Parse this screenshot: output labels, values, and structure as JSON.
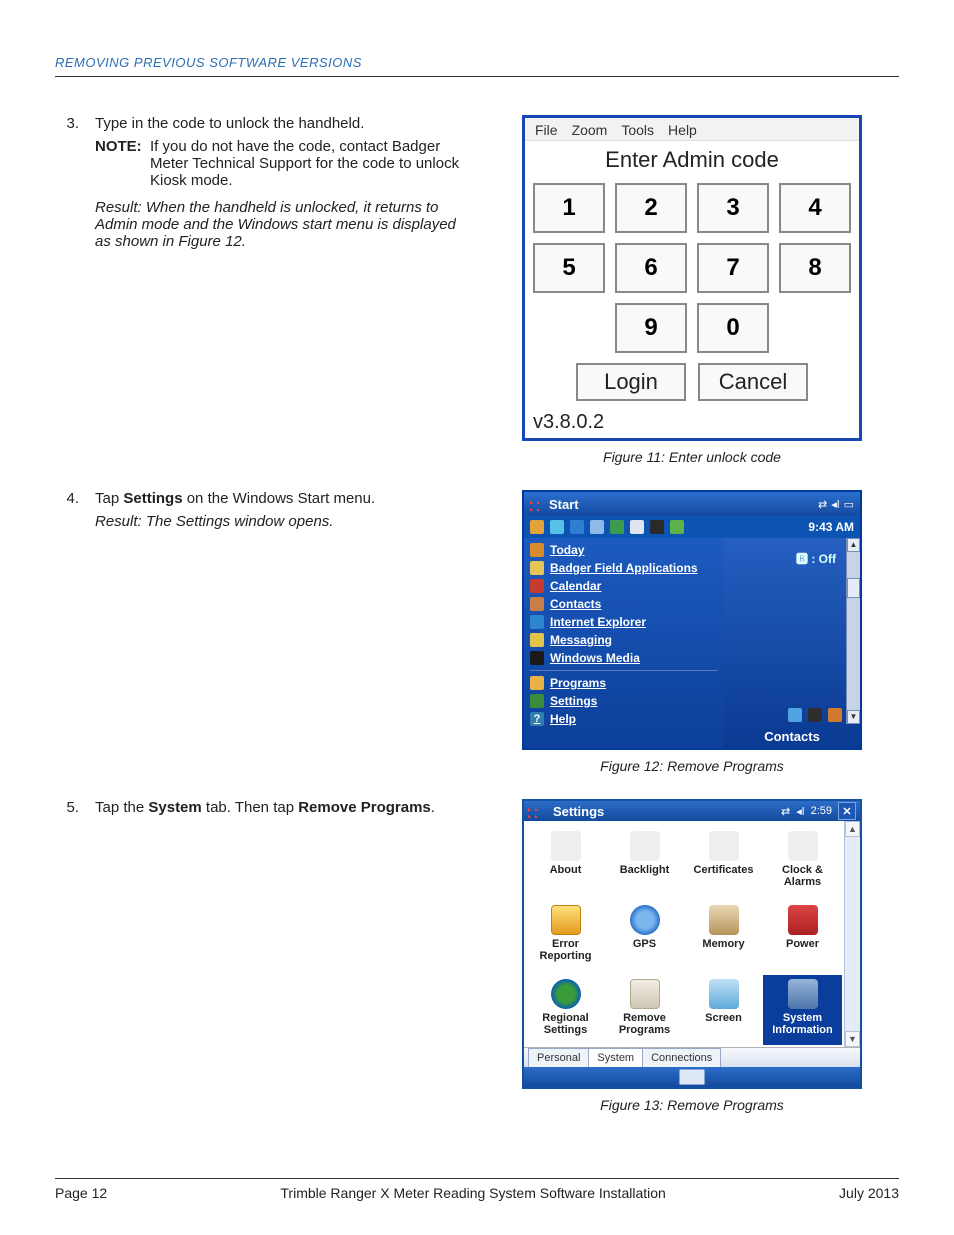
{
  "header": {
    "section_title": "REMOVING PREVIOUS SOFTWARE VERSIONS"
  },
  "steps": {
    "s3": {
      "num": "3.",
      "text": "Type in the code to unlock the handheld.",
      "note_label": "NOTE:",
      "note_text": "If you do not have the code, contact Badger Meter Technical Support for the code to unlock Kiosk mode.",
      "result": "Result: When the handheld is unlocked, it returns to Admin mode and the Windows start menu is displayed as shown in Figure 12."
    },
    "s4": {
      "num": "4.",
      "pre": "Tap ",
      "bold": "Settings",
      "post": " on the Windows Start menu.",
      "result": "Result: The Settings window opens."
    },
    "s5": {
      "num": "5.",
      "pre": "Tap the ",
      "bold1": "System",
      "mid": " tab. Then tap ",
      "bold2": "Remove Programs",
      "post": "."
    }
  },
  "fig11": {
    "menu": {
      "file": "File",
      "zoom": "Zoom",
      "tools": "Tools",
      "help": "Help"
    },
    "title": "Enter Admin code",
    "keys": [
      "1",
      "2",
      "3",
      "4",
      "5",
      "6",
      "7",
      "8",
      "",
      "9",
      "0",
      ""
    ],
    "login": "Login",
    "cancel": "Cancel",
    "version": "v3.8.0.2",
    "caption": "Figure 11:  Enter unlock code"
  },
  "fig12": {
    "title": "Start",
    "time": "9:43 AM",
    "bt": "🅱 : Off",
    "menu": [
      "Today",
      "Badger Field Applications",
      "Calendar",
      "Contacts",
      "Internet Explorer",
      "Messaging",
      "Windows Media"
    ],
    "menu2": [
      "Programs",
      "Settings",
      "Help"
    ],
    "contacts": "Contacts",
    "caption": "Figure 12:  Remove Programs"
  },
  "fig13": {
    "title": "Settings",
    "clock": "2:59",
    "items": [
      "About",
      "Backlight",
      "Certificates",
      "Clock & Alarms",
      "Error Reporting",
      "GPS",
      "Memory",
      "Power",
      "Regional Settings",
      "Remove Programs",
      "Screen",
      "System Information"
    ],
    "tabs": {
      "personal": "Personal",
      "system": "System",
      "connections": "Connections"
    },
    "caption": "Figure 13:  Remove Programs"
  },
  "footer": {
    "left": "Page 12",
    "center": "Trimble Ranger X Meter Reading System Software Installation",
    "right": "July 2013"
  }
}
